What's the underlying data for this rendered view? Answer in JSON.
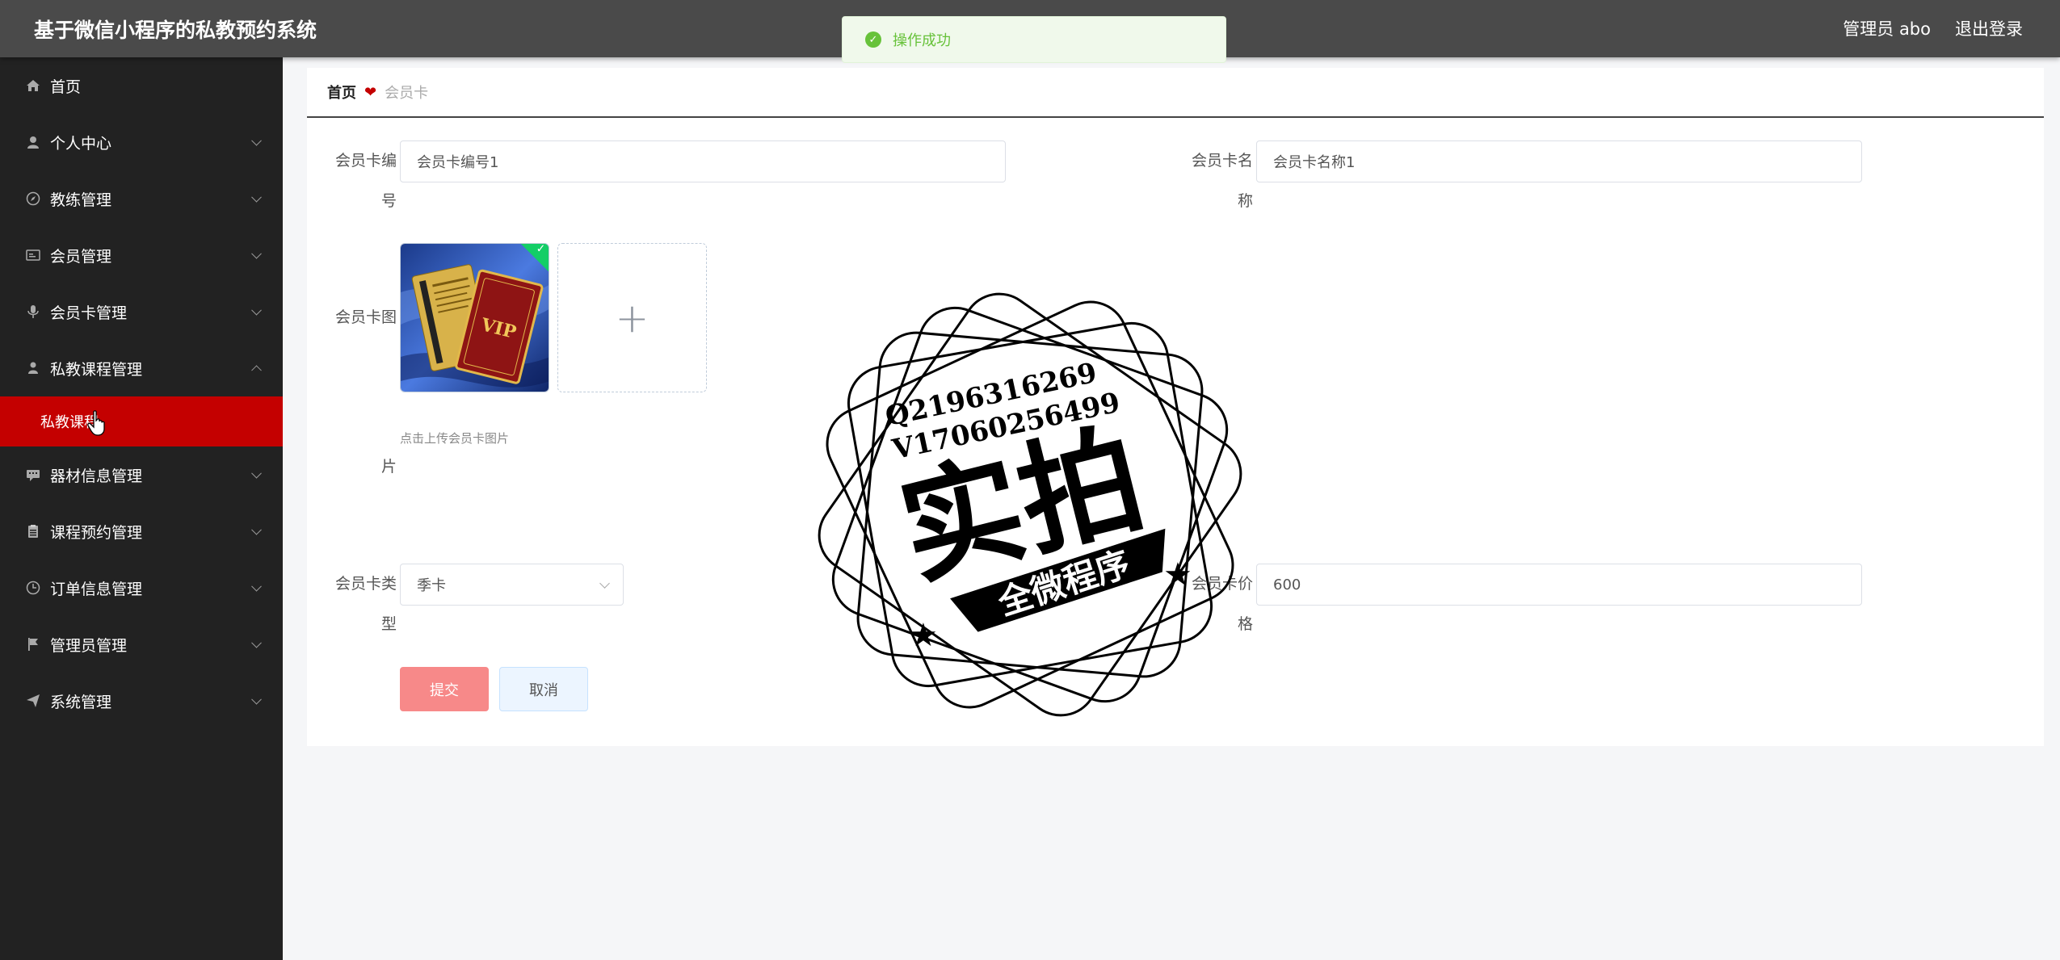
{
  "app": {
    "title": "基于微信小程序的私教预约系统"
  },
  "header": {
    "user_label": "管理员 abo",
    "logout_label": "退出登录"
  },
  "toast": {
    "text": "操作成功"
  },
  "sidebar": {
    "items": [
      {
        "label": "首页",
        "icon": "home-icon"
      },
      {
        "label": "个人中心",
        "icon": "user-icon"
      },
      {
        "label": "教练管理",
        "icon": "compass-icon"
      },
      {
        "label": "会员管理",
        "icon": "id-card-icon"
      },
      {
        "label": "会员卡管理",
        "icon": "microphone-icon"
      },
      {
        "label": "私教课程管理",
        "icon": "person-icon",
        "expanded": true,
        "children": [
          {
            "label": "私教课程",
            "active": true
          }
        ]
      },
      {
        "label": "器材信息管理",
        "icon": "chat-icon"
      },
      {
        "label": "课程预约管理",
        "icon": "clipboard-icon"
      },
      {
        "label": "订单信息管理",
        "icon": "clock-icon"
      },
      {
        "label": "管理员管理",
        "icon": "flag-icon"
      },
      {
        "label": "系统管理",
        "icon": "send-icon"
      }
    ]
  },
  "breadcrumb": {
    "home": "首页",
    "current": "会员卡"
  },
  "form": {
    "card_no": {
      "label_line1": "会员卡编",
      "label_line2": "号",
      "value": "会员卡编号1"
    },
    "card_name": {
      "label_line1": "会员卡名",
      "label_line2": "称",
      "value": "会员卡名称1"
    },
    "card_image": {
      "label_line1": "会员卡图",
      "label_line2": "片",
      "tip": "点击上传会员卡图片",
      "add_symbol": "+"
    },
    "card_type": {
      "label_line1": "会员卡类",
      "label_line2": "型",
      "value": "季卡"
    },
    "card_price": {
      "label_line1": "会员卡价",
      "label_line2": "格",
      "value": "600"
    },
    "submit_label": "提交",
    "cancel_label": "取消"
  },
  "watermark": {
    "line1": "Q2196316269",
    "line2": "V17060256499",
    "big_text": "实拍",
    "banner_text": "全微程序"
  },
  "colors": {
    "accent": "#c40000",
    "header_bg": "#4a4a4a",
    "sidebar_bg": "#222222",
    "success": "#67c23a"
  }
}
